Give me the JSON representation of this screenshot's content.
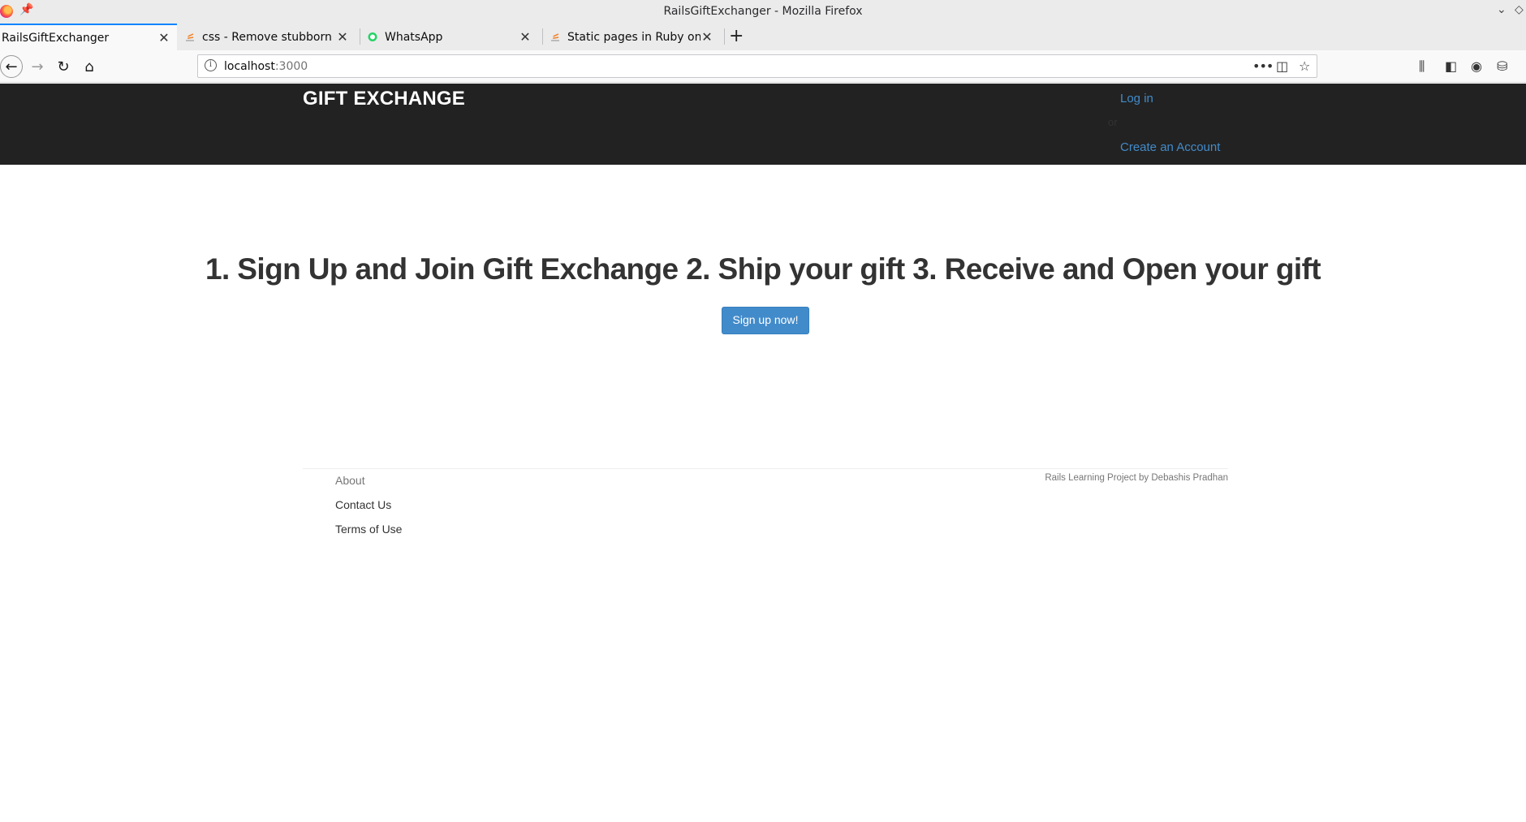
{
  "window": {
    "title": "RailsGiftExchanger - Mozilla Firefox"
  },
  "tabs": [
    {
      "label": "RailsGiftExchanger",
      "active": true
    },
    {
      "label": "css - Remove stubborn und",
      "active": false
    },
    {
      "label": "WhatsApp",
      "active": false
    },
    {
      "label": "Static pages in Ruby on Rai",
      "active": false
    }
  ],
  "urlbar": {
    "host": "localhost",
    "port": ":3000"
  },
  "site": {
    "brand": "GIFT EXCHANGE",
    "nav": {
      "login": "Log in",
      "or": "or",
      "create_account": "Create an Account"
    },
    "hero": "1. Sign Up and Join Gift Exchange 2. Ship your gift 3. Receive and Open your gift",
    "signup_button": "Sign up now!",
    "footer": {
      "links": [
        "About",
        "Contact Us",
        "Terms of Use"
      ],
      "credit": "Rails Learning Project by Debashis Pradhan"
    }
  },
  "colors": {
    "header_bg": "#222222",
    "link": "#428bca",
    "button": "#428bca",
    "tab_accent": "#0a84ff"
  }
}
